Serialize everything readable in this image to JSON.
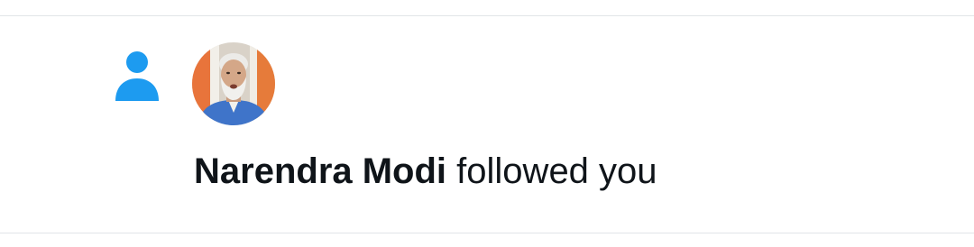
{
  "notification": {
    "type_icon": "person-icon",
    "accent_color": "#1d9bf0",
    "user": {
      "display_name": "Narendra Modi",
      "avatar": "profile-photo"
    },
    "action_text": "followed you"
  }
}
